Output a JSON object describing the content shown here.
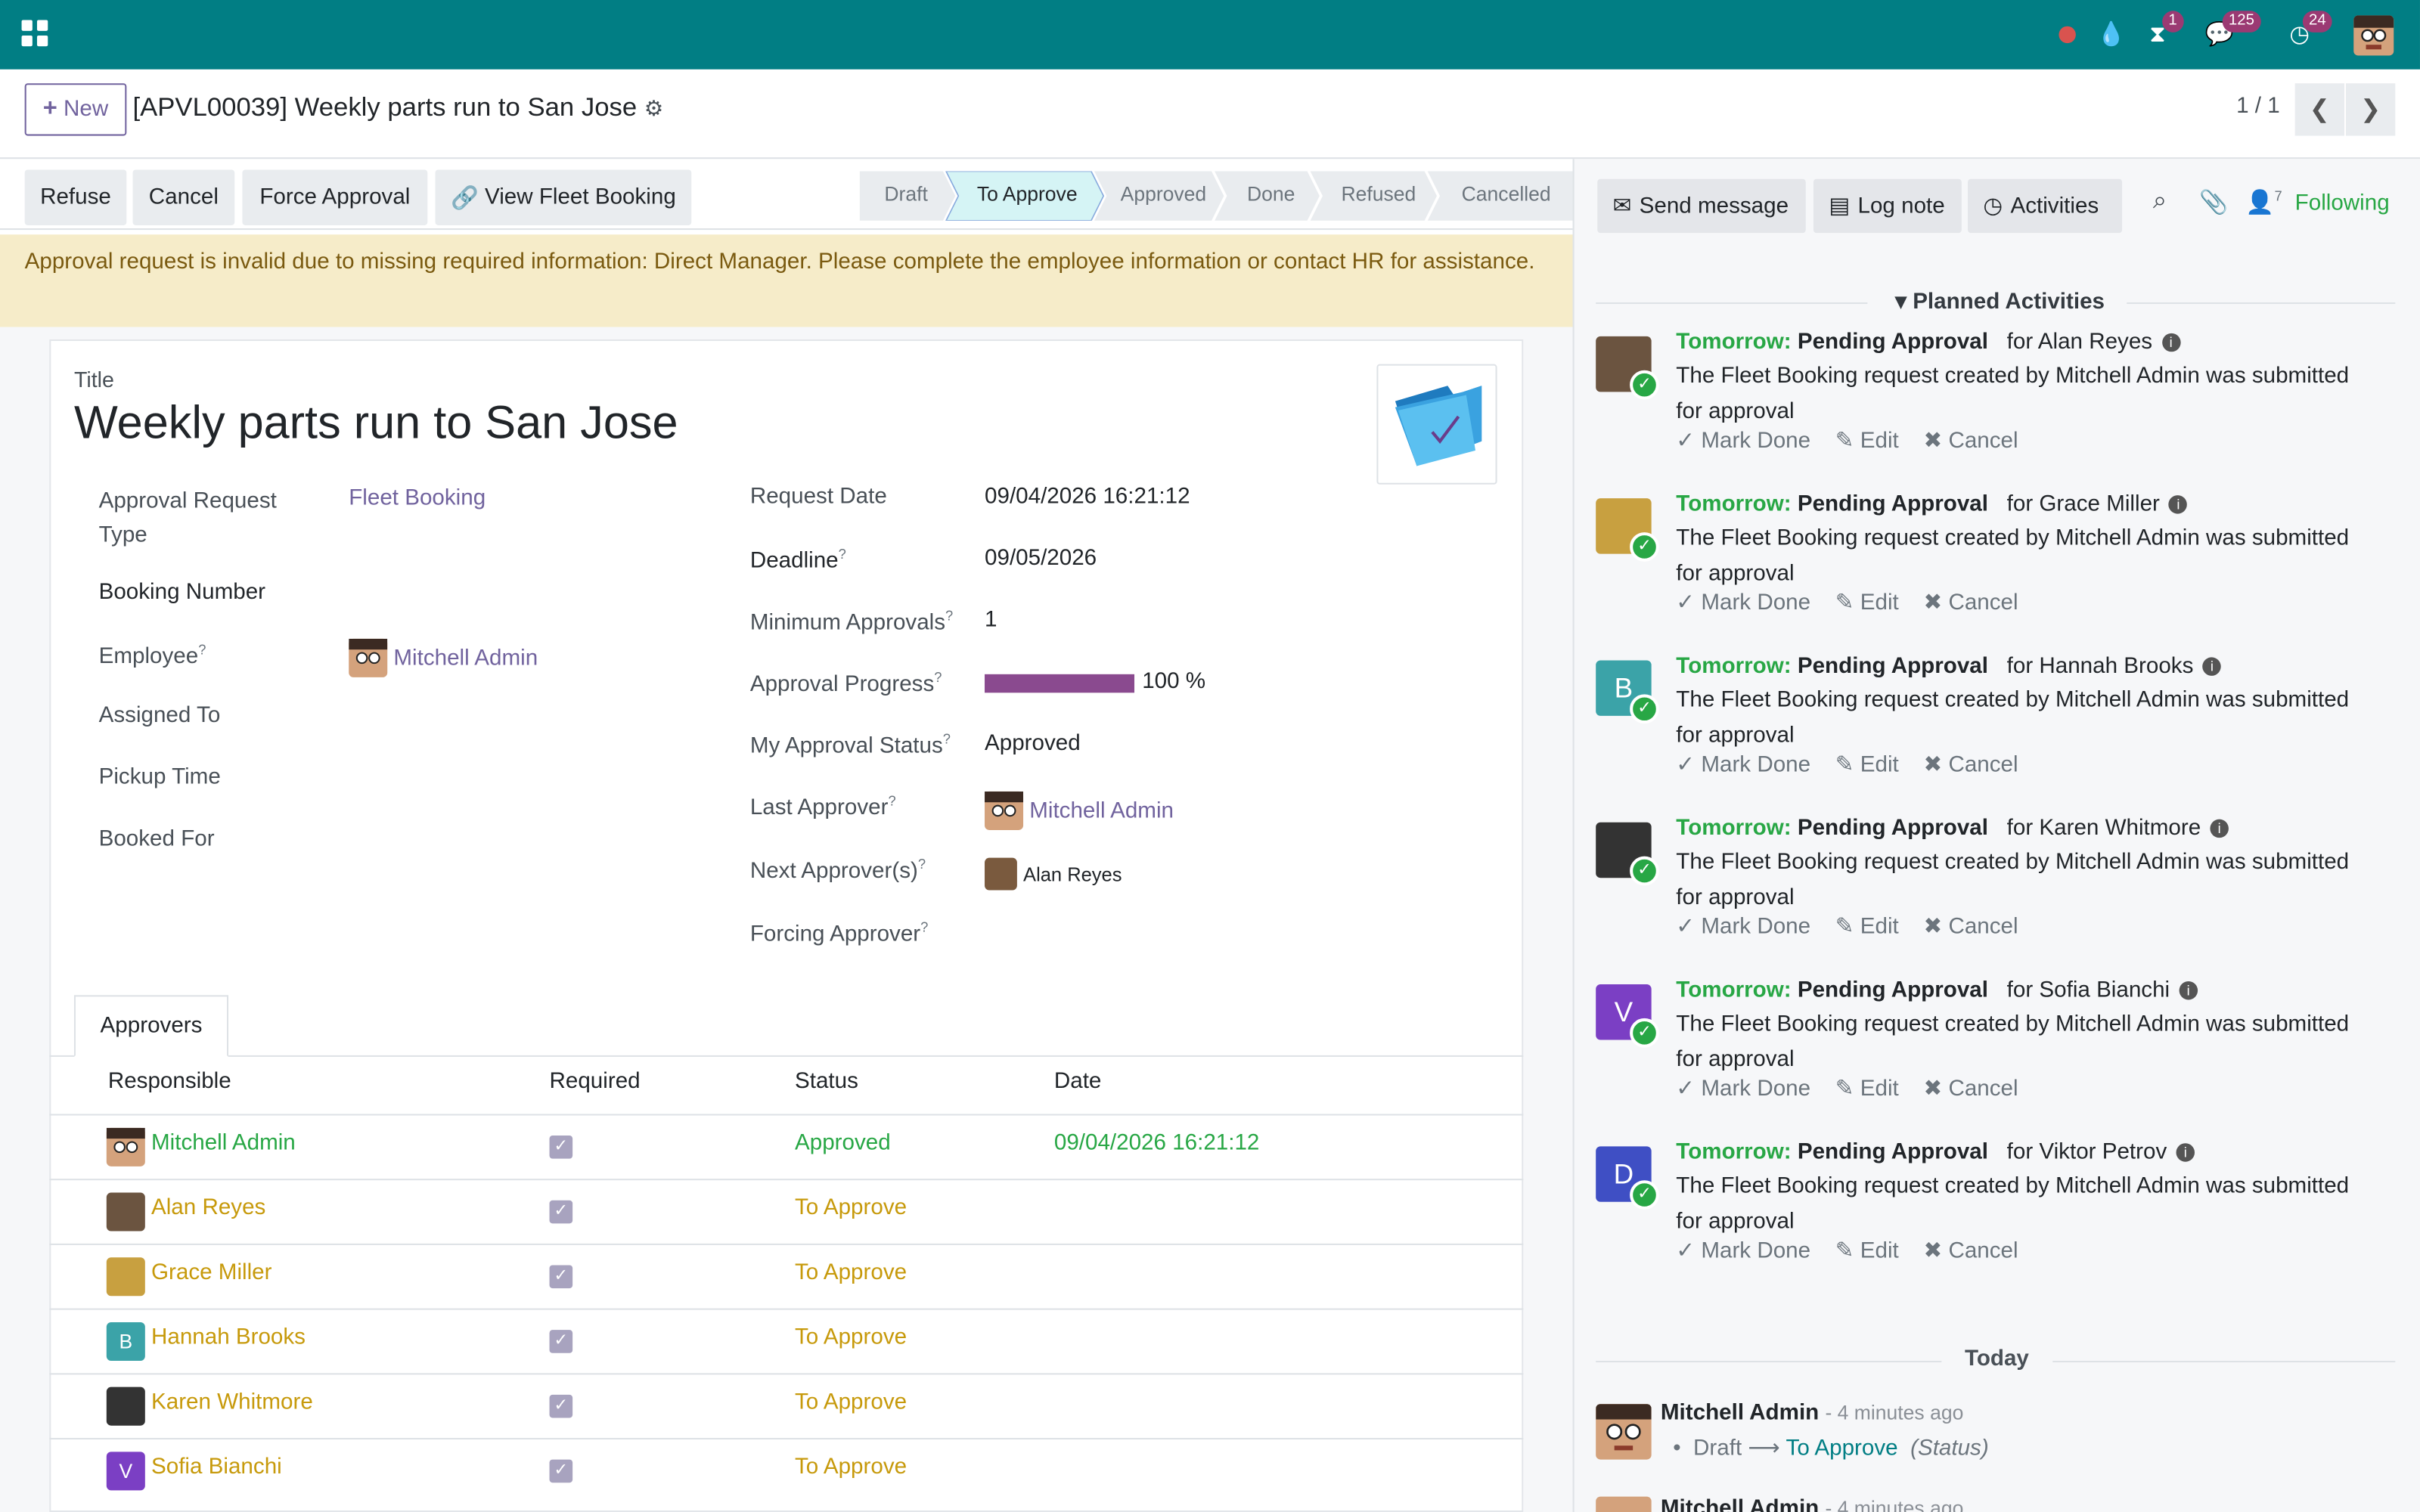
{
  "topbar": {
    "messages_count": "125",
    "activity_count": "24",
    "timer_count": "1"
  },
  "control": {
    "new_label": "New",
    "record_title": "[APVL00039] Weekly parts run to San Jose",
    "pager": "1 / 1"
  },
  "actions": {
    "refuse": "Refuse",
    "cancel": "Cancel",
    "force": "Force Approval",
    "view_fleet": "View Fleet Booking"
  },
  "stages": [
    "Draft",
    "To Approve",
    "Approved",
    "Done",
    "Refused",
    "Cancelled"
  ],
  "alert": "Approval request is invalid due to missing required information: Direct Manager. Please complete the employee information or contact HR for assistance.",
  "form": {
    "title_label": "Title",
    "title": "Weekly parts run to San Jose",
    "left": {
      "type_label_1": "Approval Request",
      "type_label_2": "Type",
      "type_value": "Fleet Booking",
      "booking_label": "Booking Number",
      "employee_label": "Employee",
      "employee_value": "Mitchell Admin",
      "assigned_label": "Assigned To",
      "pickup_label": "Pickup Time",
      "booked_label": "Booked For"
    },
    "right": {
      "request_date_label": "Request Date",
      "request_date": "09/04/2026 16:21:12",
      "deadline_label": "Deadline",
      "deadline": "09/05/2026",
      "min_label": "Minimum Approvals",
      "min_value": "1",
      "progress_label": "Approval Progress",
      "progress_value": "100 %",
      "progress_fraction": 1.0,
      "my_status_label": "My Approval Status",
      "my_status": "Approved",
      "last_label": "Last Approver",
      "last_value": "Mitchell Admin",
      "next_label": "Next Approver(s)",
      "next_value": "Alan Reyes",
      "forcing_label": "Forcing Approver"
    },
    "tab": "Approvers",
    "headers": {
      "responsible": "Responsible",
      "required": "Required",
      "status": "Status",
      "date": "Date"
    },
    "rows": [
      {
        "name": "Mitchell Admin",
        "status": "Approved",
        "date": "09/04/2026 16:21:12"
      },
      {
        "name": "Alan Reyes",
        "status": "To Approve",
        "date": ""
      },
      {
        "name": "Grace Miller",
        "status": "To Approve",
        "date": ""
      },
      {
        "name": "Hannah Brooks",
        "status": "To Approve",
        "date": ""
      },
      {
        "name": "Karen Whitmore",
        "status": "To Approve",
        "date": ""
      },
      {
        "name": "Sofia Bianchi",
        "status": "To Approve",
        "date": ""
      }
    ]
  },
  "chatter": {
    "send": "Send message",
    "log": "Log note",
    "activities": "Activities",
    "followers_count": "7",
    "following": "Following",
    "planned": "Planned Activities",
    "tomorrow": "Tomorrow:",
    "pending": "Pending Approval",
    "desc_1": "The Fleet Booking request created by Mitchell Admin was submitted",
    "desc_2": "for approval",
    "mark_done": "Mark Done",
    "edit": "Edit",
    "cancel": "Cancel",
    "items": [
      {
        "for": "for Alan Reyes"
      },
      {
        "for": "for Grace Miller"
      },
      {
        "for": "for Hannah Brooks"
      },
      {
        "for": "for Karen Whitmore"
      },
      {
        "for": "for Sofia Bianchi"
      },
      {
        "for": "for Viktor Petrov"
      }
    ],
    "today": "Today",
    "msg_author": "Mitchell Admin",
    "msg_time": "- 4 minutes ago",
    "msg_from": "Draft",
    "msg_to": "To Approve",
    "msg_field": "(Status)",
    "msg2_author": "Mitchell Admin",
    "msg2_time": "- 4 minutes ago"
  },
  "colors": {
    "brand": "#017e84",
    "primary": "#71639e",
    "success": "#28a745",
    "warning": "#c79a0c"
  }
}
